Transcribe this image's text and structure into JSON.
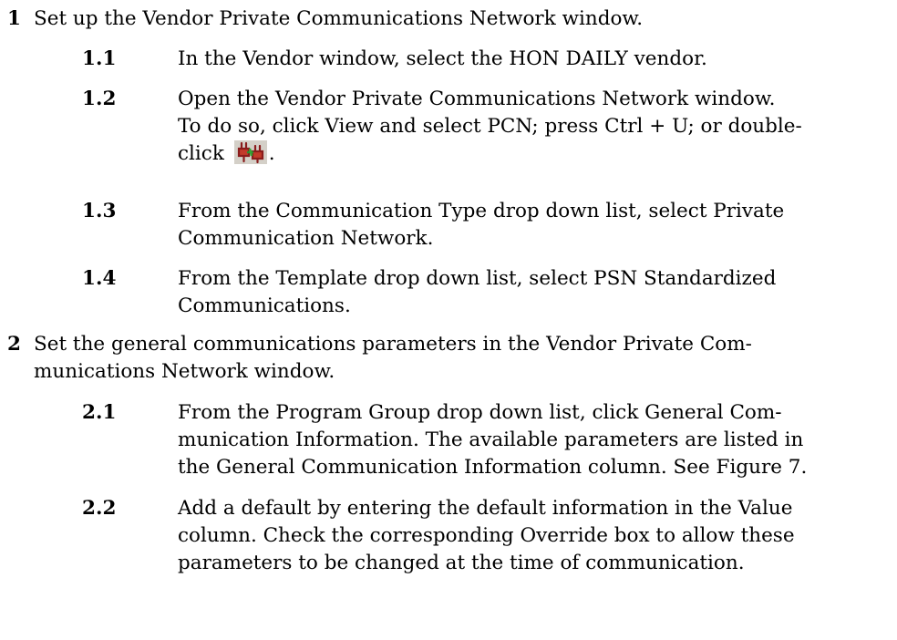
{
  "steps": [
    {
      "number": "1",
      "text": "Set up the Vendor Private Communications Network window.",
      "substeps": [
        {
          "number": "1.1",
          "lines": [
            "In the Vendor window, select the HON DAILY vendor."
          ]
        },
        {
          "number": "1.2",
          "lines": [
            "Open the Vendor Private Communications Network window.",
            "To do so, click View and select PCN; press Ctrl + U; or double-"
          ],
          "line3_before_icon": "click ",
          "line3_after_icon": ".",
          "icon": "network-connect-icon"
        },
        {
          "number": "1.3",
          "lines": [
            "From the Communication Type drop down list, select Private",
            "Communication Network."
          ]
        },
        {
          "number": "1.4",
          "lines": [
            "From the Template drop down list, select PSN Standardized",
            "Communications."
          ]
        }
      ]
    },
    {
      "number": "2",
      "lines": [
        "Set the general communications parameters in the Vendor Private Com-",
        "munications Network window."
      ],
      "substeps": [
        {
          "number": "2.1",
          "lines": [
            "From the Program Group drop down list, click General Com-",
            "munication Information. The available parameters are listed in",
            "the General Communication Information column. See Figure 7."
          ]
        },
        {
          "number": "2.2",
          "lines": [
            "Add a default by entering the default information in the Value",
            "column. Check the corresponding Override box to allow these",
            "parameters to be changed at the time of communication."
          ]
        }
      ]
    }
  ]
}
